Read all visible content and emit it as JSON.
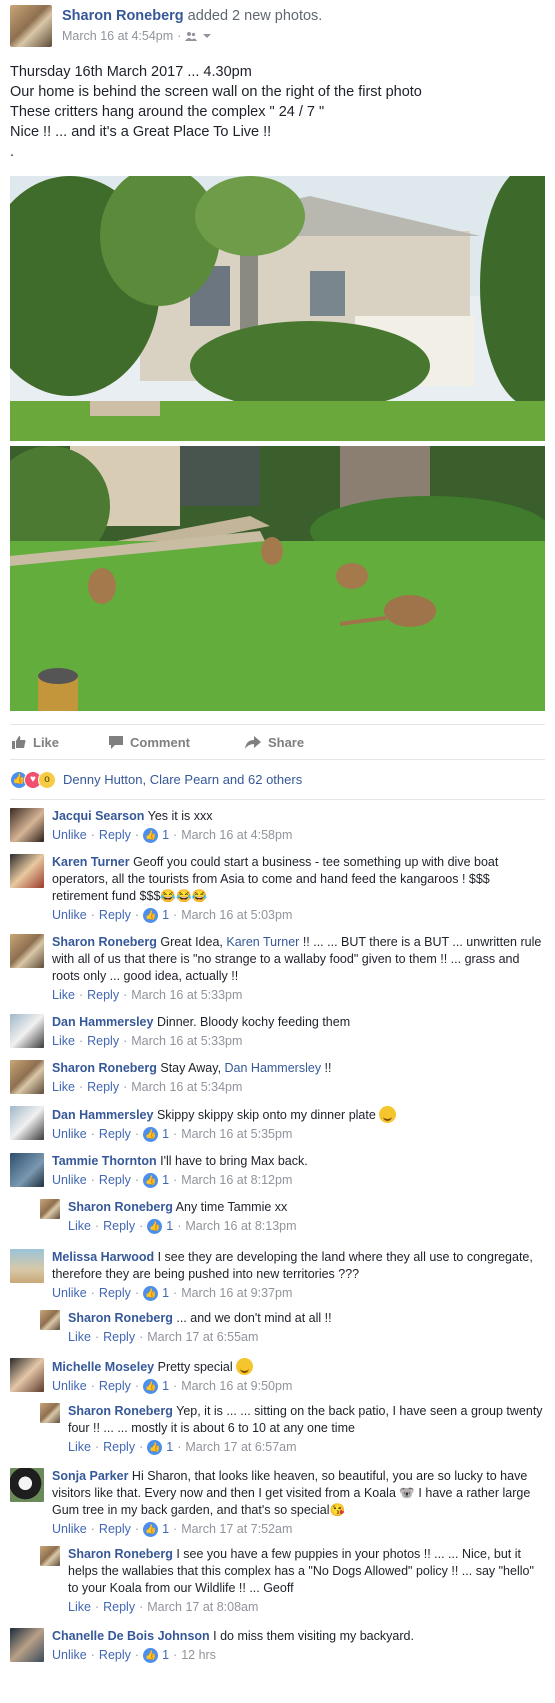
{
  "post": {
    "author": "Sharon Roneberg",
    "action": " added 2 new photos.",
    "timestamp": "March 16 at 4:54pm",
    "text": "Thursday 16th March 2017 ... 4.30pm\nOur home is behind the screen wall on the right of the first photo\nThese critters hang around the complex \" 24 / 7 \"\nNice !! ... and it's a Great Place To Live !!\n."
  },
  "actions": {
    "like": "Like",
    "comment": "Comment",
    "share": "Share"
  },
  "reactions": {
    "summary": "Denny Hutton, Clare Pearn and 62 others"
  },
  "comments": [
    {
      "name": "Jacqui Searson",
      "text": "Yes it is xxx",
      "action": "Unlike",
      "reply": "Reply",
      "likes": "1",
      "time": "March 16 at 4:58pm"
    },
    {
      "name": "Karen Turner",
      "text": "Geoff you could start a business - tee something up with dive boat operators, all the tourists from Asia to come and hand feed the kangaroos ! $$$ retirement fund $$$😂😂😂",
      "action": "Unlike",
      "reply": "Reply",
      "likes": "1",
      "time": "March 16 at 5:03pm"
    },
    {
      "name": "Sharon Roneberg",
      "text_before": "Great Idea, ",
      "mention": "Karen Turner",
      "text_after": " !! ... ... BUT there is a BUT ... unwritten rule with all of us that there is \"no strange to a wallaby food\" given to them !! ... grass and roots only ... good idea, actually !!",
      "action": "Like",
      "reply": "Reply",
      "time": "March 16 at 5:33pm"
    },
    {
      "name": "Dan Hammersley",
      "text": "Dinner. Bloody kochy feeding them",
      "action": "Like",
      "reply": "Reply",
      "time": "March 16 at 5:33pm"
    },
    {
      "name": "Sharon Roneberg",
      "text_before": "Stay Away, ",
      "mention": "Dan Hammersley",
      "text_after": " !!",
      "action": "Like",
      "reply": "Reply",
      "time": "March 16 at 5:34pm"
    },
    {
      "name": "Dan Hammersley",
      "text": "Skippy skippy skip onto my dinner plate",
      "action": "Unlike",
      "reply": "Reply",
      "likes": "1",
      "time": "March 16 at 5:35pm"
    },
    {
      "name": "Tammie Thornton",
      "text": "I'll have to bring Max back.",
      "action": "Unlike",
      "reply": "Reply",
      "likes": "1",
      "time": "March 16 at 8:12pm",
      "reply_item": {
        "name": "Sharon Roneberg",
        "text": "Any time Tammie xx",
        "action": "Like",
        "reply": "Reply",
        "likes": "1",
        "time": "March 16 at 8:13pm"
      }
    },
    {
      "name": "Melissa Harwood",
      "text": "I see they are developing the land where they all use to congregate, therefore they are being pushed into new territories ???",
      "action": "Unlike",
      "reply": "Reply",
      "likes": "1",
      "time": "March 16 at 9:37pm",
      "reply_item": {
        "name": "Sharon Roneberg",
        "text": "... and we don't mind at all !!",
        "action": "Like",
        "reply": "Reply",
        "time": "March 17 at 6:55am"
      }
    },
    {
      "name": "Michelle Moseley",
      "text": "Pretty special",
      "action": "Unlike",
      "reply": "Reply",
      "likes": "1",
      "time": "March 16 at 9:50pm",
      "reply_item": {
        "name": "Sharon Roneberg",
        "text": "Yep, it is ... ... sitting on the back patio, I have seen a group twenty four !! ... ... mostly it is about 6 to 10 at any one time",
        "action": "Like",
        "reply": "Reply",
        "likes": "1",
        "time": "March 17 at 6:57am"
      }
    },
    {
      "name": "Sonja Parker",
      "text": "Hi Sharon, that looks like heaven, so beautiful, you are so lucky to have visitors like that. Every now and then I get visited from a Koala 🐨 I have a rather large Gum tree in my back garden, and that's so special😘",
      "action": "Unlike",
      "reply": "Reply",
      "likes": "1",
      "time": "March 17 at 7:52am",
      "reply_item": {
        "name": "Sharon Roneberg",
        "text": "I see you have a few puppies in your photos !! ... ... Nice, but it helps the wallabies that this complex has a \"No Dogs Allowed\" policy !! ... say \"hello\" to your Koala from our Wildlife !! ... Geoff",
        "action": "Like",
        "reply": "Reply",
        "time": "March 17 at 8:08am"
      }
    },
    {
      "name": "Chanelle De Bois Johnson",
      "text": "I do miss them visiting my backyard.",
      "action": "Unlike",
      "reply": "Reply",
      "likes": "1",
      "time": "12 hrs"
    }
  ],
  "colors": {
    "link": "#365899",
    "meta": "#90949c",
    "like_blue": "#4c8fec",
    "grass": "#5ea83a"
  }
}
